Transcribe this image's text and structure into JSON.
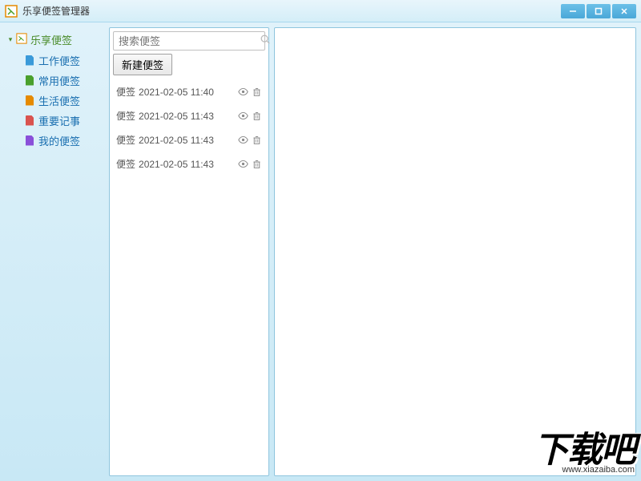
{
  "window": {
    "title": "乐享便签管理器"
  },
  "sidebar": {
    "root_label": "乐享便签",
    "items": [
      {
        "label": "工作便签",
        "color": "#3a9ad9"
      },
      {
        "label": "常用便签",
        "color": "#4aa02c"
      },
      {
        "label": "生活便签",
        "color": "#e68a00"
      },
      {
        "label": "重要记事",
        "color": "#d9534f"
      },
      {
        "label": "我的便签",
        "color": "#8a4fd9"
      }
    ]
  },
  "search": {
    "placeholder": "搜索便签"
  },
  "actions": {
    "new_note": "新建便签"
  },
  "notes": [
    {
      "title": "便签",
      "date": "2021-02-05 11:40"
    },
    {
      "title": "便签",
      "date": "2021-02-05 11:43"
    },
    {
      "title": "便签",
      "date": "2021-02-05 11:43"
    },
    {
      "title": "便签",
      "date": "2021-02-05 11:43"
    }
  ],
  "watermark": {
    "main": "下载吧",
    "sub": "www.xiazaiba.com"
  }
}
